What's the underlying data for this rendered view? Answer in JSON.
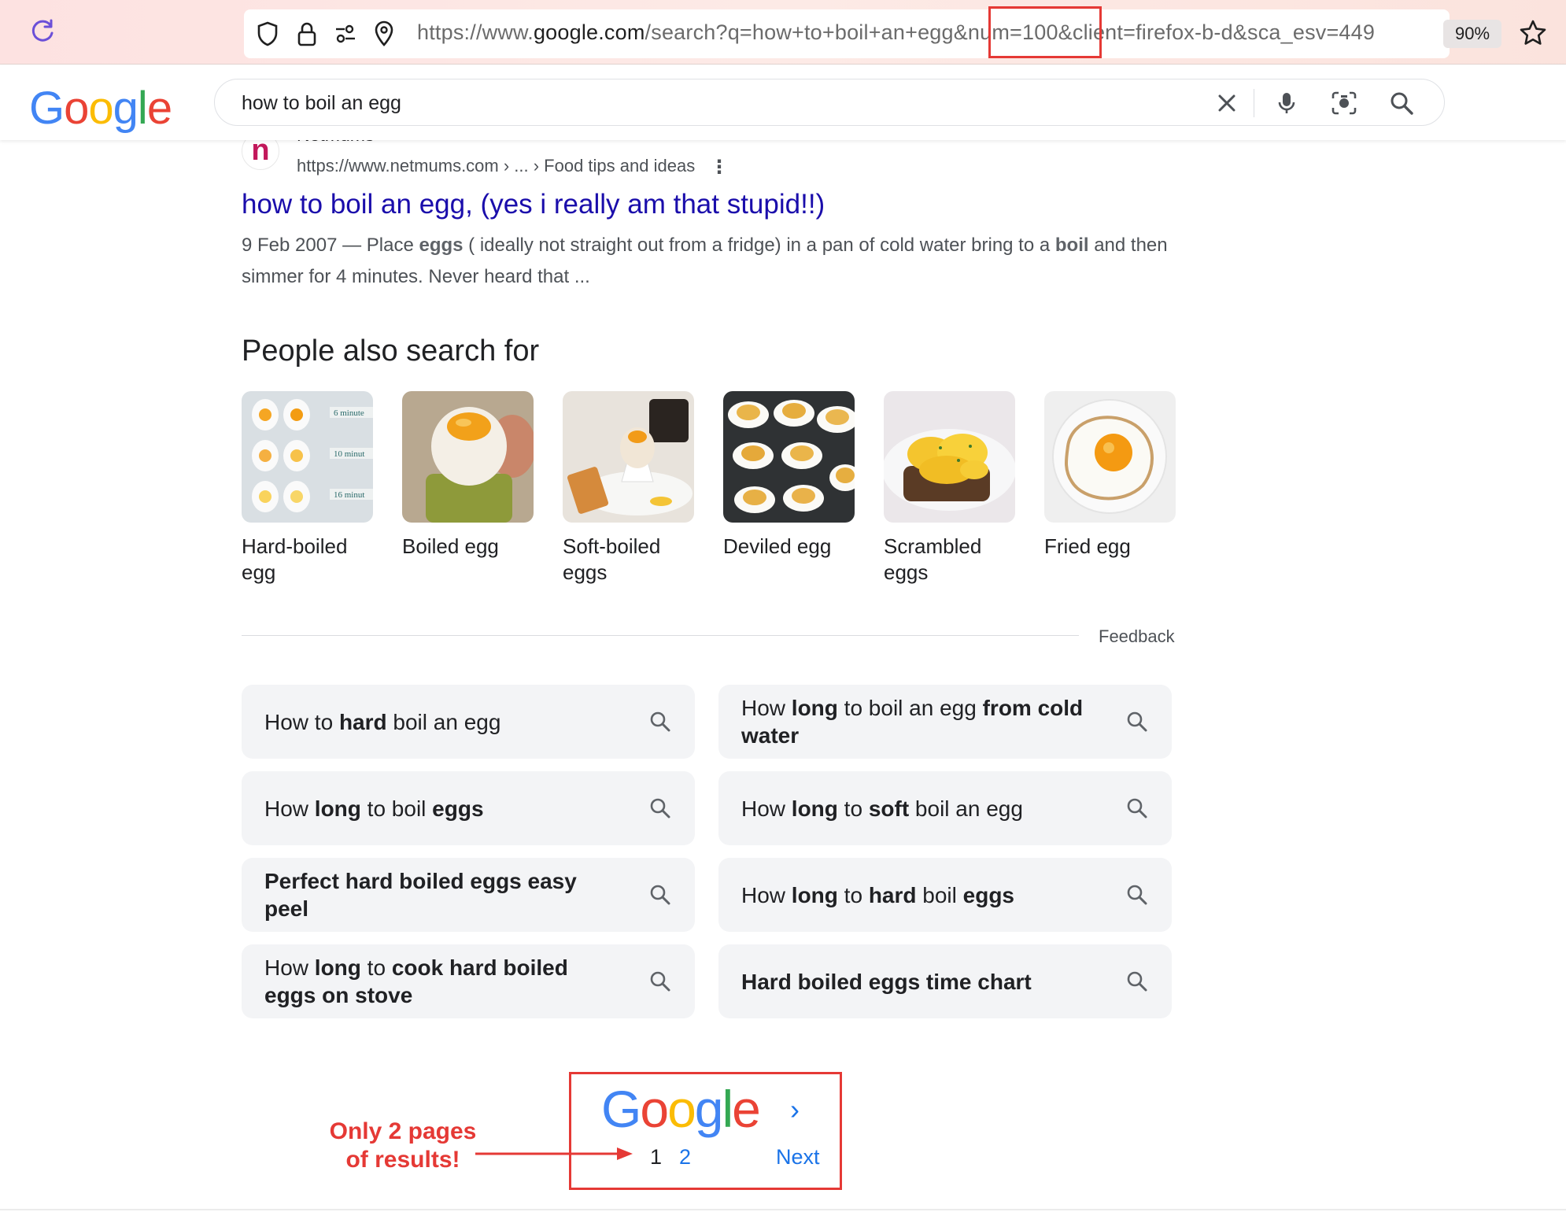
{
  "browser": {
    "url_prefix": "https://www.",
    "url_domain": "google.com",
    "url_rest": "/search?q=how+to+boil+an+egg&num=100&client=firefox-b-d&sca_esv=449",
    "zoom": "90%"
  },
  "search": {
    "query": "how to boil an egg"
  },
  "result": {
    "site_name": "Netmums",
    "favicon_letter": "n",
    "url": "https://www.netmums.com › ... › Food tips and ideas",
    "title": "how to boil an egg, (yes i really am that stupid!!)",
    "snippet_1": "9 Feb 2007 — Place ",
    "snippet_b1": "eggs",
    "snippet_2": " ( ideally not straight out from a fridge) in a pan of cold water bring to a ",
    "snippet_b2": "boil",
    "snippet_3": " and then simmer for 4 minutes. Never heard that ..."
  },
  "pasf": {
    "title": "People also search for",
    "items": [
      {
        "label": "Hard-boiled egg",
        "img_text_1": "6 minute",
        "img_text_2": "10 minut",
        "img_text_3": "16 minut"
      },
      {
        "label": "Boiled egg"
      },
      {
        "label": "Soft-boiled eggs"
      },
      {
        "label": "Deviled egg"
      },
      {
        "label": "Scrambled eggs"
      },
      {
        "label": "Fried egg"
      }
    ]
  },
  "feedback": "Feedback",
  "related": [
    {
      "parts": [
        [
          "How to ",
          false
        ],
        [
          "hard",
          true
        ],
        [
          " boil an egg",
          false
        ]
      ]
    },
    {
      "parts": [
        [
          "How ",
          false
        ],
        [
          "long",
          true
        ],
        [
          " to boil an egg ",
          false
        ],
        [
          "from cold water",
          true
        ]
      ]
    },
    {
      "parts": [
        [
          "How ",
          false
        ],
        [
          "long",
          true
        ],
        [
          " to boil ",
          false
        ],
        [
          "eggs",
          true
        ]
      ]
    },
    {
      "parts": [
        [
          "How ",
          false
        ],
        [
          "long",
          true
        ],
        [
          " to ",
          false
        ],
        [
          "soft",
          true
        ],
        [
          " boil an egg",
          false
        ]
      ]
    },
    {
      "parts": [
        [
          "Perfect hard boiled eggs easy peel",
          true
        ]
      ]
    },
    {
      "parts": [
        [
          "How ",
          false
        ],
        [
          "long",
          true
        ],
        [
          " to ",
          false
        ],
        [
          "hard",
          true
        ],
        [
          " boil ",
          false
        ],
        [
          "eggs",
          true
        ]
      ]
    },
    {
      "parts": [
        [
          "How ",
          false
        ],
        [
          "long",
          true
        ],
        [
          " to ",
          false
        ],
        [
          "cook hard boiled eggs on stove",
          true
        ]
      ]
    },
    {
      "parts": [
        [
          "Hard boiled eggs time chart",
          true
        ]
      ]
    }
  ],
  "pager": {
    "page_1": "1",
    "page_2": "2",
    "next": "Next"
  },
  "annotation": {
    "line_1": "Only 2 pages",
    "line_2": "of results!"
  },
  "colors": {
    "g_blue": "#4285F4",
    "g_red": "#EA4335",
    "g_yellow": "#FBBC05",
    "g_green": "#34A853",
    "link": "#1a0dab",
    "annotation_red": "#e53935"
  }
}
